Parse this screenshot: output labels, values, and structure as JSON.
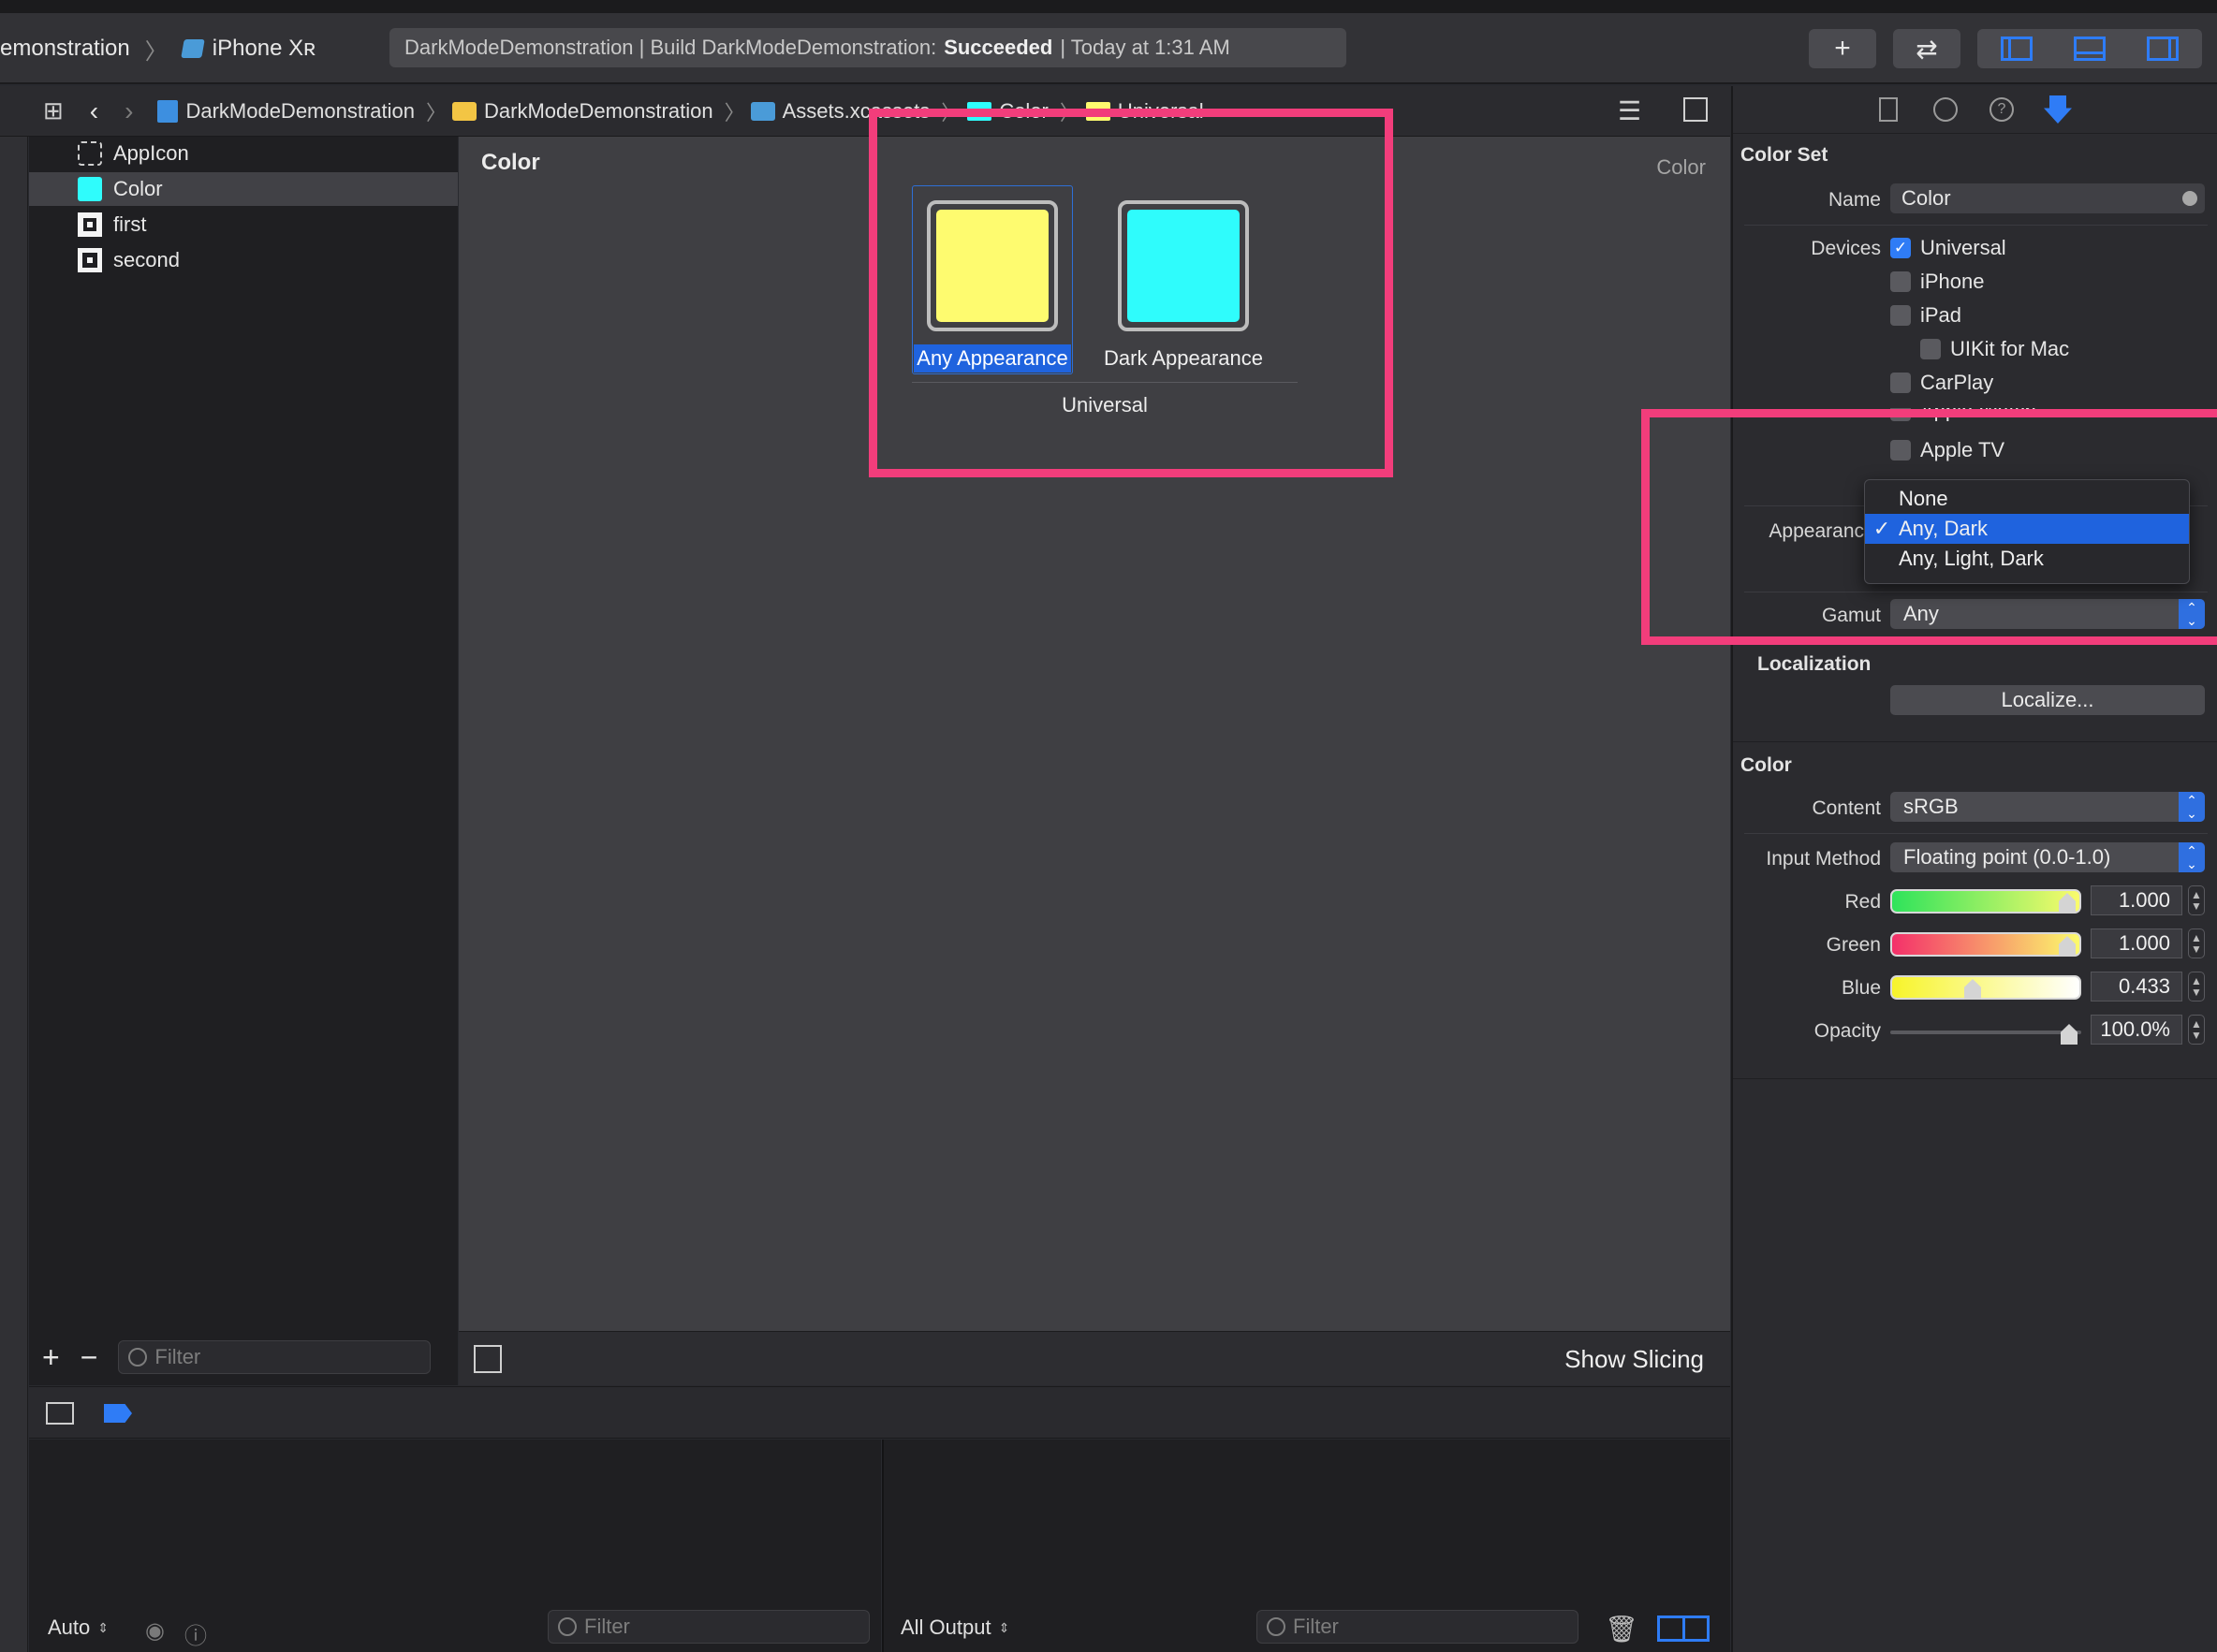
{
  "toolbar": {
    "scheme_target": "emonstration",
    "device": "iPhone Xʀ",
    "activity_prefix": "DarkModeDemonstration | Build DarkModeDemonstration:",
    "activity_status": "Succeeded",
    "activity_time": "| Today at 1:31 AM",
    "add_symbol": "+",
    "swap_symbol": "⇄"
  },
  "jumpbar": {
    "crumbs": [
      "DarkModeDemonstration",
      "DarkModeDemonstration",
      "Assets.xcassets",
      "Color",
      "Universal"
    ]
  },
  "assets": [
    {
      "name": "AppIcon"
    },
    {
      "name": "Color"
    },
    {
      "name": "first"
    },
    {
      "name": "second"
    }
  ],
  "list_filter_placeholder": "Filter",
  "canvas": {
    "title": "Color",
    "right_label": "Color",
    "wells": [
      {
        "label": "Any Appearance",
        "color": "#fefb6f"
      },
      {
        "label": "Dark Appearance",
        "color": "#2ffcfc"
      }
    ],
    "group_label": "Universal",
    "show_slicing": "Show Slicing"
  },
  "debug": {
    "auto_label": "Auto",
    "filter_left": "Filter",
    "output_label": "All Output",
    "filter_right": "Filter"
  },
  "inspector": {
    "section_colorset": "Color Set",
    "name_label": "Name",
    "name_value": "Color",
    "devices_label": "Devices",
    "devices": [
      {
        "label": "Universal",
        "checked": true
      },
      {
        "label": "iPhone",
        "checked": false
      },
      {
        "label": "iPad",
        "checked": false
      },
      {
        "label": "UIKit for Mac",
        "checked": false
      },
      {
        "label": "CarPlay",
        "checked": false
      },
      {
        "label": "Apple Watch",
        "checked": false
      },
      {
        "label": "Apple TV",
        "checked": false
      }
    ],
    "appearances_label": "Appearanc",
    "appearance_options": [
      {
        "label": "None",
        "selected": false
      },
      {
        "label": "Any, Dark",
        "selected": true
      },
      {
        "label": "Any, Light, Dark",
        "selected": false
      }
    ],
    "gamut_label": "Gamut",
    "gamut_value": "Any",
    "localization_head": "Localization",
    "localize_button": "Localize...",
    "section_color": "Color",
    "content_label": "Content",
    "content_value": "sRGB",
    "input_method_label": "Input Method",
    "input_method_value": "Floating point (0.0-1.0)",
    "channels": [
      {
        "label": "Red",
        "value": "1.000",
        "level": 1.0
      },
      {
        "label": "Green",
        "value": "1.000",
        "level": 1.0
      },
      {
        "label": "Blue",
        "value": "0.433",
        "level": 0.433
      },
      {
        "label": "Opacity",
        "value": "100.0%",
        "level": 1.0
      }
    ]
  },
  "colors": {
    "accent": "#2f7cf6",
    "highlight_frame": "#f23d7b"
  }
}
